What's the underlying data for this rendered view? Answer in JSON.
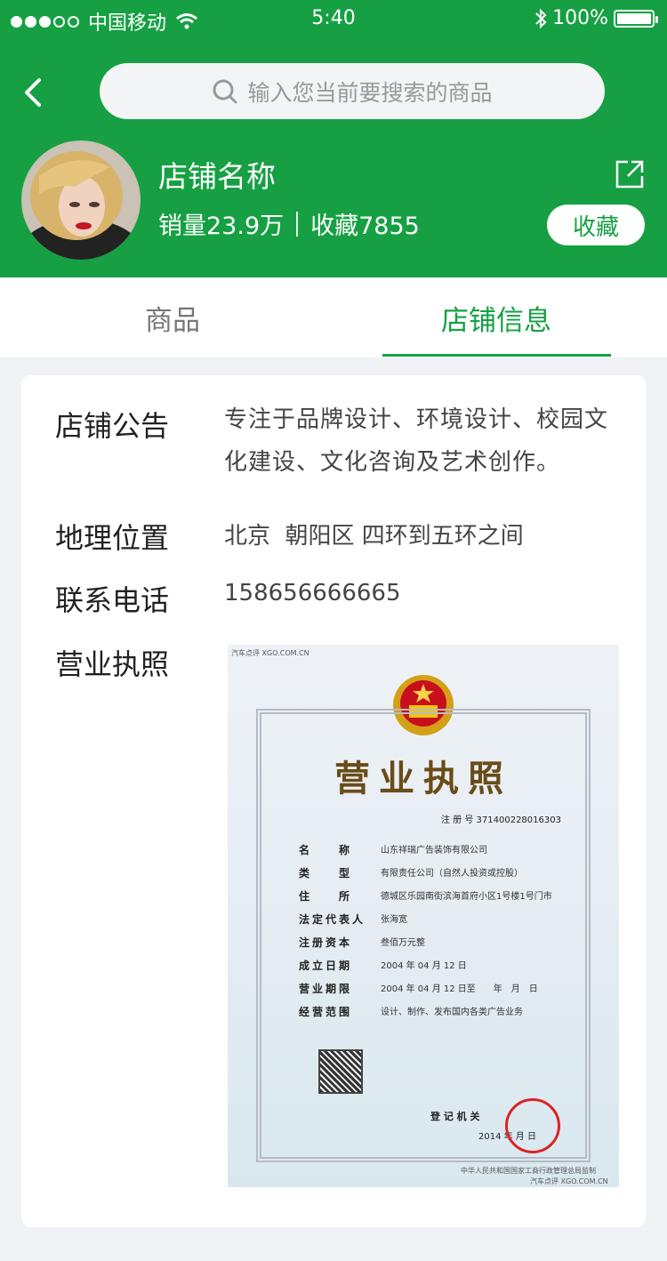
{
  "status_bar": {
    "carrier": "中国移动",
    "time": "5:40",
    "battery": "100%"
  },
  "search": {
    "placeholder": "输入您当前要搜索的商品"
  },
  "shop": {
    "name": "店铺名称",
    "sales": "销量23.9万",
    "favorites": "收藏7855",
    "favorite_button": "收藏"
  },
  "tabs": [
    {
      "label": "商品"
    },
    {
      "label": "店铺信息"
    }
  ],
  "info": {
    "notice_label": "店铺公告",
    "notice_text": "专注于品牌设计、环境设计、校园文化建设、文化咨询及艺术创作。",
    "location_label": "地理位置",
    "location_text": "北京  朝阳区 四环到五环之间",
    "phone_label": "联系电话",
    "phone_text": "158656666665",
    "license_label": "营业执照"
  },
  "license": {
    "title": "营业执照",
    "reg_no": "注 册 号 371400228016303",
    "rows": [
      {
        "k": "名　　称",
        "v": "山东祥瑞广告装饰有限公司"
      },
      {
        "k": "类　　型",
        "v": "有限责任公司（自然人投资或控股）"
      },
      {
        "k": "住　　所",
        "v": "德城区乐园南街滨海首府小区1号楼1号门市"
      },
      {
        "k": "法定代表人",
        "v": "张海宽"
      },
      {
        "k": "注册资本",
        "v": "叁佰万元整"
      },
      {
        "k": "成立日期",
        "v": "2004 年 04 月 12 日"
      },
      {
        "k": "营业期限",
        "v": "2004 年 04 月 12 日至　　年　月　日"
      },
      {
        "k": "经营范围",
        "v": "设计、制作、发布国内各类广告业务"
      }
    ],
    "authority": "登 记 机 关",
    "date": "2014 年  月  日",
    "footer": "中华人民共和国国家工商行政管理总局监制",
    "watermark_top": "汽车点评 XGO.COM.CN",
    "watermark_bottom": "汽车点评 XGO.COM.CN"
  }
}
